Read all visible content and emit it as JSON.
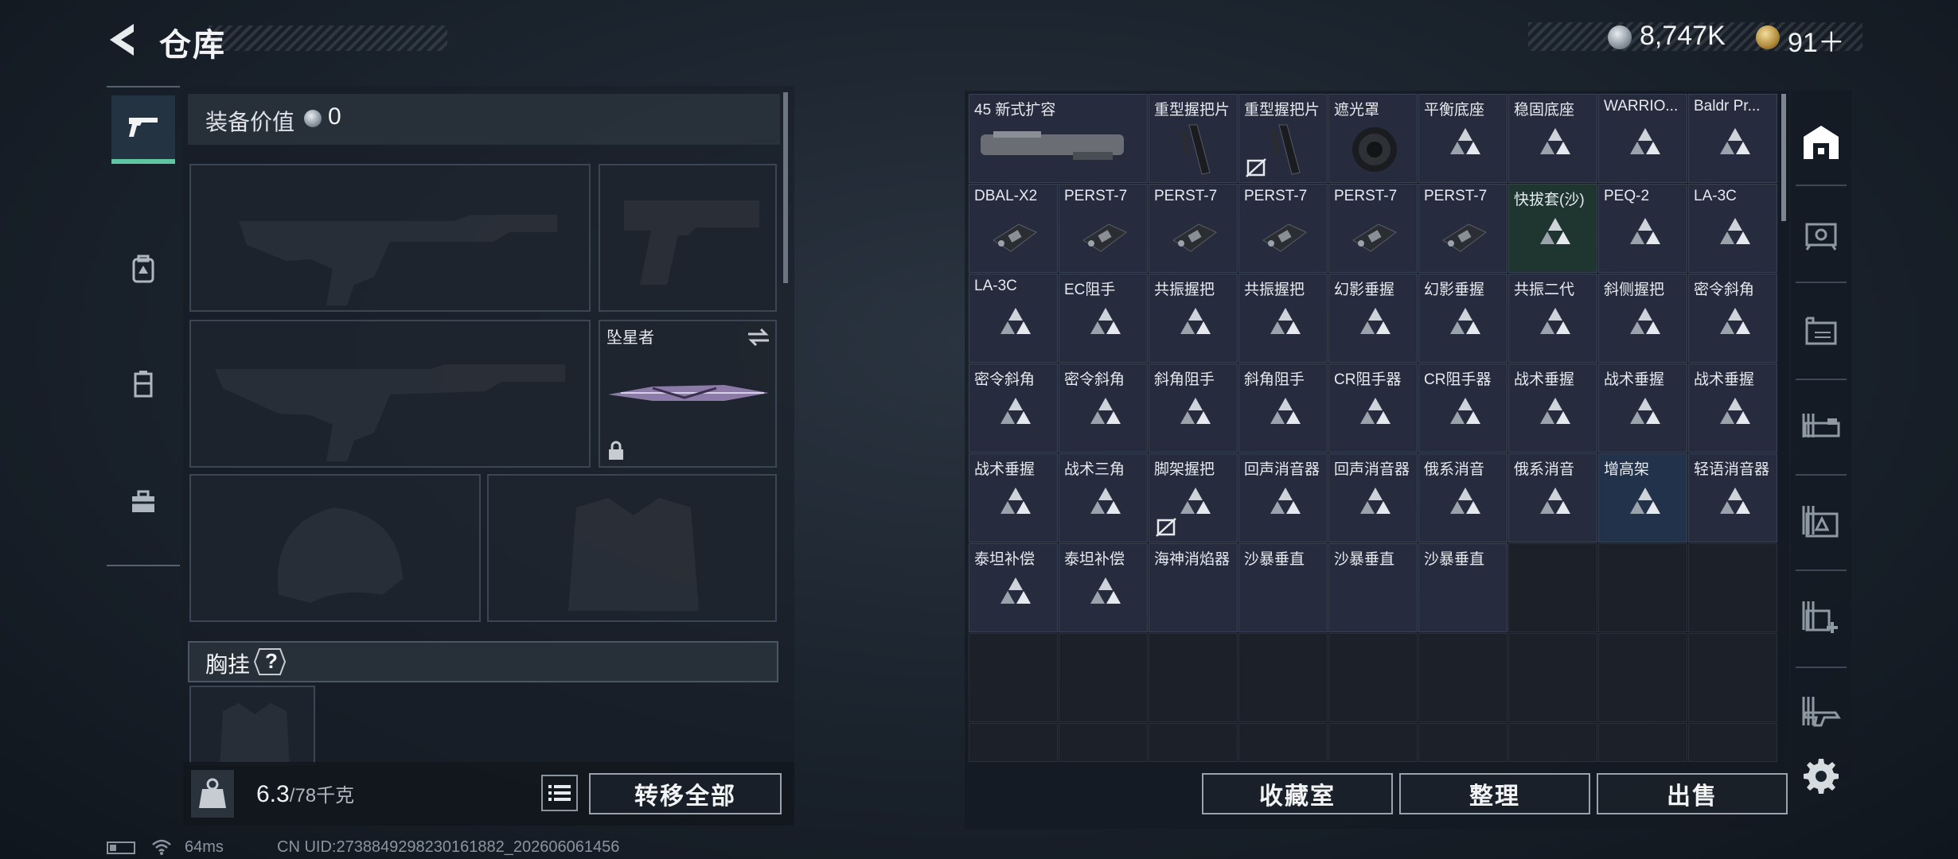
{
  "header": {
    "title": "仓库"
  },
  "currency": {
    "silver": "8,747K",
    "gold": "91＋"
  },
  "equipment": {
    "value_label": "装备价值",
    "value_amount": "0",
    "melee_name": "坠星者",
    "chest_label": "胸挂",
    "chest_help": "?",
    "weight_current": "6.3",
    "weight_max": "/78千克",
    "transfer_all": "转移全部"
  },
  "inventory": {
    "items": [
      {
        "name": "45 新式扩容",
        "icon": "extended-mag",
        "wide": true
      },
      {
        "name": "重型握把片",
        "icon": "grip-panel"
      },
      {
        "name": "重型握把片",
        "icon": "grip-panel",
        "locked": true
      },
      {
        "name": "遮光罩",
        "icon": "lens-hood"
      },
      {
        "name": "平衡底座",
        "icon": "triangle-placeholder"
      },
      {
        "name": "稳固底座",
        "icon": "triangle-placeholder"
      },
      {
        "name": "WARRIO...",
        "icon": "triangle-placeholder"
      },
      {
        "name": "Baldr Pr...",
        "icon": "triangle-placeholder"
      },
      {
        "name": "DBAL-X2",
        "icon": "laser-module"
      },
      {
        "name": "PERST-7",
        "icon": "laser-module"
      },
      {
        "name": "PERST-7",
        "icon": "laser-module"
      },
      {
        "name": "PERST-7",
        "icon": "laser-module"
      },
      {
        "name": "PERST-7",
        "icon": "laser-module"
      },
      {
        "name": "PERST-7",
        "icon": "laser-module"
      },
      {
        "name": "快拔套(沙)",
        "icon": "triangle-placeholder",
        "tint": "green"
      },
      {
        "name": "PEQ-2",
        "icon": "triangle-placeholder"
      },
      {
        "name": "LA-3C",
        "icon": "triangle-placeholder"
      },
      {
        "name": "LA-3C",
        "icon": "triangle-placeholder"
      },
      {
        "name": "EC阻手",
        "icon": "triangle-placeholder"
      },
      {
        "name": "共振握把",
        "icon": "triangle-placeholder"
      },
      {
        "name": "共振握把",
        "icon": "triangle-placeholder"
      },
      {
        "name": "幻影垂握",
        "icon": "triangle-placeholder"
      },
      {
        "name": "幻影垂握",
        "icon": "triangle-placeholder"
      },
      {
        "name": "共振二代",
        "icon": "triangle-placeholder"
      },
      {
        "name": "斜侧握把",
        "icon": "triangle-placeholder"
      },
      {
        "name": "密令斜角",
        "icon": "triangle-placeholder"
      },
      {
        "name": "密令斜角",
        "icon": "triangle-placeholder"
      },
      {
        "name": "密令斜角",
        "icon": "triangle-placeholder"
      },
      {
        "name": "斜角阻手",
        "icon": "triangle-placeholder"
      },
      {
        "name": "斜角阻手",
        "icon": "triangle-placeholder"
      },
      {
        "name": "CR阻手器",
        "icon": "triangle-placeholder"
      },
      {
        "name": "CR阻手器",
        "icon": "triangle-placeholder"
      },
      {
        "name": "战术垂握",
        "icon": "triangle-placeholder"
      },
      {
        "name": "战术垂握",
        "icon": "triangle-placeholder"
      },
      {
        "name": "战术垂握",
        "icon": "triangle-placeholder"
      },
      {
        "name": "战术垂握",
        "icon": "triangle-placeholder"
      },
      {
        "name": "战术三角",
        "icon": "triangle-placeholder"
      },
      {
        "name": "脚架握把",
        "icon": "triangle-placeholder",
        "locked": true
      },
      {
        "name": "回声消音器",
        "icon": "triangle-placeholder"
      },
      {
        "name": "回声消音器",
        "icon": "triangle-placeholder"
      },
      {
        "name": "俄系消音",
        "icon": "triangle-placeholder"
      },
      {
        "name": "俄系消音",
        "icon": "triangle-placeholder"
      },
      {
        "name": "增高架",
        "icon": "triangle-placeholder",
        "tint": "blue"
      },
      {
        "name": "轻语消音器",
        "icon": "triangle-placeholder"
      },
      {
        "name": "泰坦补偿",
        "icon": "triangle-placeholder"
      },
      {
        "name": "泰坦补偿",
        "icon": "triangle-placeholder"
      },
      {
        "name": "海神消焰器",
        "icon": "none"
      },
      {
        "name": "沙暴垂直",
        "icon": "none"
      },
      {
        "name": "沙暴垂直",
        "icon": "none"
      },
      {
        "name": "沙暴垂直",
        "icon": "none"
      }
    ],
    "buttons": {
      "collection": "收藏室",
      "sort": "整理",
      "sell": "出售"
    }
  },
  "status": {
    "ping": "64ms",
    "uid": "CN UID:2738849298230161882_202606061456"
  }
}
